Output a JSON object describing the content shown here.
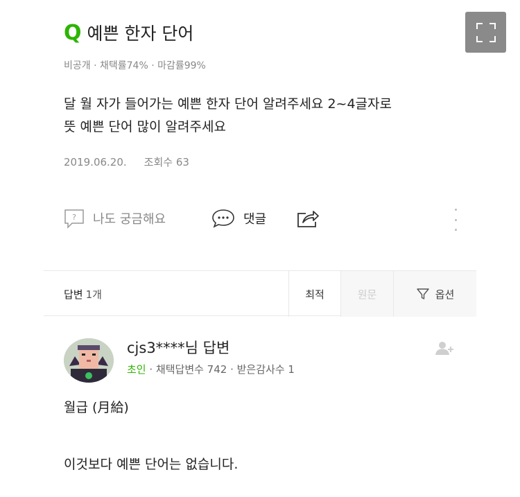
{
  "question": {
    "title": "예쁜 한자 단어",
    "meta": "비공개 · 채택률74% · 마감률99%",
    "body_line1": "달 월 자가 들어가는 예쁜 한자 단어 알려주세요 2~4글자로",
    "body_line2": "뜻 예쁜 단어 많이 알려주세요",
    "date": "2019.06.20.",
    "views": "조회수 63"
  },
  "actions": {
    "wonder_label": "나도 궁금해요",
    "comment_label": "댓글"
  },
  "answers_bar": {
    "label": "답변",
    "count": "1개",
    "sort_latest": "최적",
    "sort_original": "원문",
    "options": "옵션"
  },
  "answer": {
    "author": "cjs3****님 답변",
    "rank": "초인",
    "meta": " · 채택답변수 742 · 받은감사수 1",
    "line1": "월급 (月給)",
    "line2": "이것보다 예쁜 단어는 없습니다."
  },
  "colors": {
    "brand_green": "#2db400",
    "meta_gray": "#888888",
    "expand_button_bg": "#8a8a8a"
  },
  "icons": {
    "expand": "fullscreen-icon",
    "wonder": "question-box-icon",
    "comment": "speech-bubble-icon",
    "share": "share-icon",
    "more": "kebab-menu-icon",
    "filter": "filter-icon",
    "follow": "add-user-icon"
  }
}
